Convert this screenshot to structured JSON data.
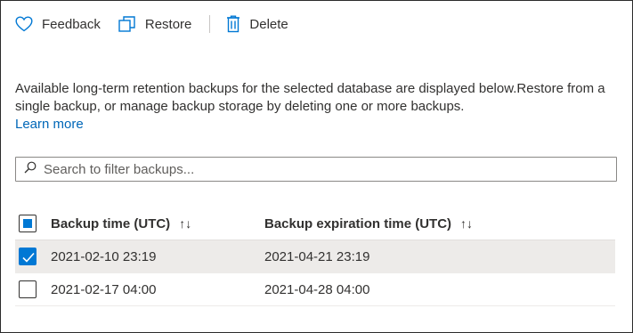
{
  "toolbar": {
    "feedback_label": "Feedback",
    "restore_label": "Restore",
    "delete_label": "Delete"
  },
  "description": {
    "text": "Available long-term retention backups for the selected database are displayed below.Restore from a single backup, or manage backup storage by deleting one or more backups.",
    "link": "Learn more"
  },
  "search": {
    "placeholder": "Search to filter backups..."
  },
  "table": {
    "columns": [
      "Backup time (UTC)",
      "Backup expiration time (UTC)"
    ],
    "sort_icon": "↑↓",
    "rows": [
      {
        "backup_time": "2021-02-10 23:19",
        "expiration_time": "2021-04-21 23:19",
        "selected": true
      },
      {
        "backup_time": "2021-02-17 04:00",
        "expiration_time": "2021-04-28 04:00",
        "selected": false
      }
    ]
  },
  "colors": {
    "accent": "#0078d4",
    "link": "#0067b8",
    "selected_row": "#edebe9",
    "text": "#323130"
  },
  "icons": [
    "heart-icon",
    "restore-icon",
    "trash-icon",
    "search-icon",
    "sort-icon",
    "checkmark-icon"
  ]
}
